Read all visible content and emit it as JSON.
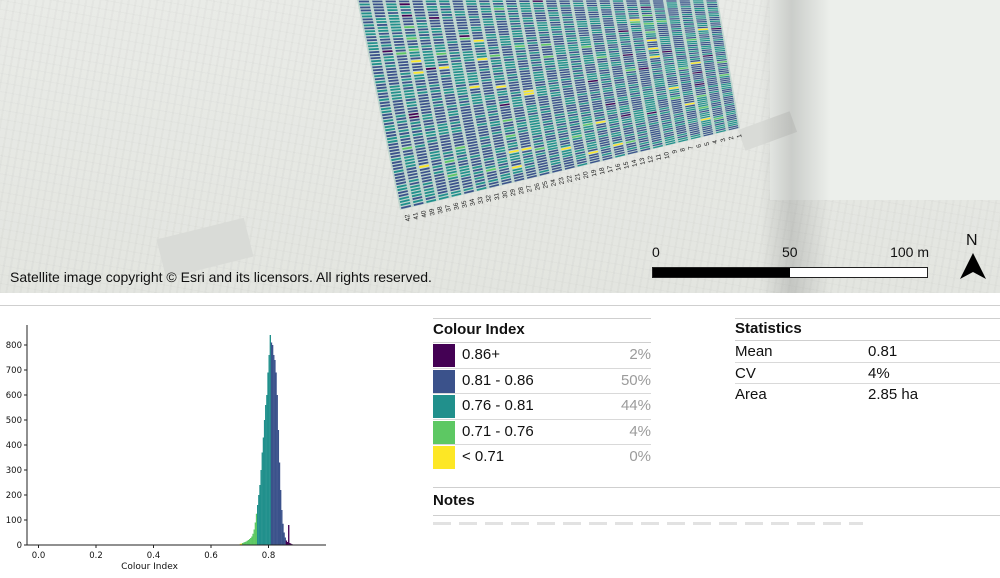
{
  "map": {
    "copyright": "Satellite image copyright © Esri and its licensors. All rights reserved.",
    "scale_bar": {
      "labels": [
        "0",
        "50",
        "100 m"
      ],
      "filled_fraction": 0.5
    },
    "north_label": "N",
    "row_labels": [
      "42",
      "41",
      "40",
      "39",
      "38",
      "37",
      "36",
      "35",
      "34",
      "33",
      "32",
      "31",
      "30",
      "29",
      "28",
      "27",
      "26",
      "25",
      "24",
      "23",
      "22",
      "21",
      "20",
      "19",
      "18",
      "17",
      "16",
      "15",
      "14",
      "13",
      "12",
      "11",
      "10",
      "9",
      "8",
      "7",
      "6",
      "5",
      "4",
      "3",
      "2",
      "1"
    ]
  },
  "colors": {
    "class_86_plus": "#440154",
    "class_81_86": "#3b528b",
    "class_76_81": "#21908c",
    "class_71_76": "#5dc863",
    "class_lt_71": "#fde725"
  },
  "legend": {
    "title": "Colour Index",
    "items": [
      {
        "label": "0.86+",
        "percent": "2%",
        "color": "#440154"
      },
      {
        "label": "0.81 - 0.86",
        "percent": "50%",
        "color": "#3b528b"
      },
      {
        "label": "0.76 - 0.81",
        "percent": "44%",
        "color": "#21908c"
      },
      {
        "label": "0.71 - 0.76",
        "percent": "4%",
        "color": "#5dc863"
      },
      {
        "label": "< 0.71",
        "percent": "0%",
        "color": "#fde725"
      }
    ]
  },
  "stats": {
    "title": "Statistics",
    "rows": [
      {
        "key": "Mean",
        "value": "0.81"
      },
      {
        "key": "CV",
        "value": "4%"
      },
      {
        "key": "Area",
        "value": "2.85 ha"
      }
    ]
  },
  "notes": {
    "title": "Notes"
  },
  "chart_data": {
    "type": "bar",
    "xlabel": "Colour Index",
    "ylabel": "",
    "xlim": [
      -0.04,
      1.0
    ],
    "ylim": [
      0,
      880
    ],
    "x_ticks": [
      "0.0",
      "0.2",
      "0.4",
      "0.6",
      "0.8"
    ],
    "x_tick_values": [
      0.0,
      0.2,
      0.4,
      0.6,
      0.8
    ],
    "y_ticks": [
      "0",
      "100",
      "200",
      "300",
      "400",
      "500",
      "600",
      "700",
      "800"
    ],
    "y_tick_values": [
      0,
      100,
      200,
      300,
      400,
      500,
      600,
      700,
      800
    ],
    "bin_width": 0.004,
    "bins": [
      {
        "x": 0.7,
        "count": 5
      },
      {
        "x": 0.704,
        "count": 6
      },
      {
        "x": 0.708,
        "count": 8
      },
      {
        "x": 0.712,
        "count": 10
      },
      {
        "x": 0.716,
        "count": 12
      },
      {
        "x": 0.72,
        "count": 14
      },
      {
        "x": 0.724,
        "count": 17
      },
      {
        "x": 0.728,
        "count": 20
      },
      {
        "x": 0.732,
        "count": 24
      },
      {
        "x": 0.736,
        "count": 28
      },
      {
        "x": 0.74,
        "count": 34
      },
      {
        "x": 0.744,
        "count": 45
      },
      {
        "x": 0.748,
        "count": 62
      },
      {
        "x": 0.752,
        "count": 90
      },
      {
        "x": 0.756,
        "count": 125
      },
      {
        "x": 0.76,
        "count": 160
      },
      {
        "x": 0.764,
        "count": 200
      },
      {
        "x": 0.768,
        "count": 240
      },
      {
        "x": 0.772,
        "count": 300
      },
      {
        "x": 0.776,
        "count": 370
      },
      {
        "x": 0.78,
        "count": 430
      },
      {
        "x": 0.784,
        "count": 500
      },
      {
        "x": 0.788,
        "count": 560
      },
      {
        "x": 0.792,
        "count": 600
      },
      {
        "x": 0.796,
        "count": 690
      },
      {
        "x": 0.8,
        "count": 760
      },
      {
        "x": 0.804,
        "count": 840
      },
      {
        "x": 0.808,
        "count": 810
      },
      {
        "x": 0.812,
        "count": 800
      },
      {
        "x": 0.816,
        "count": 760
      },
      {
        "x": 0.82,
        "count": 740
      },
      {
        "x": 0.824,
        "count": 690
      },
      {
        "x": 0.828,
        "count": 600
      },
      {
        "x": 0.832,
        "count": 460
      },
      {
        "x": 0.836,
        "count": 330
      },
      {
        "x": 0.84,
        "count": 220
      },
      {
        "x": 0.844,
        "count": 140
      },
      {
        "x": 0.848,
        "count": 85
      },
      {
        "x": 0.852,
        "count": 50
      },
      {
        "x": 0.856,
        "count": 30
      },
      {
        "x": 0.86,
        "count": 18
      },
      {
        "x": 0.864,
        "count": 12
      },
      {
        "x": 0.868,
        "count": 80
      },
      {
        "x": 0.872,
        "count": 8
      },
      {
        "x": 0.876,
        "count": 5
      },
      {
        "x": 0.88,
        "count": 3
      },
      {
        "x": 0.884,
        "count": 2
      },
      {
        "x": 0.888,
        "count": 2
      },
      {
        "x": 0.892,
        "count": 1
      },
      {
        "x": 0.896,
        "count": 1
      },
      {
        "x": 0.9,
        "count": 1
      }
    ],
    "class_breaks": [
      0.71,
      0.76,
      0.81,
      0.86
    ],
    "class_colors": [
      "#fde725",
      "#5dc863",
      "#21908c",
      "#3b528b",
      "#440154"
    ]
  }
}
